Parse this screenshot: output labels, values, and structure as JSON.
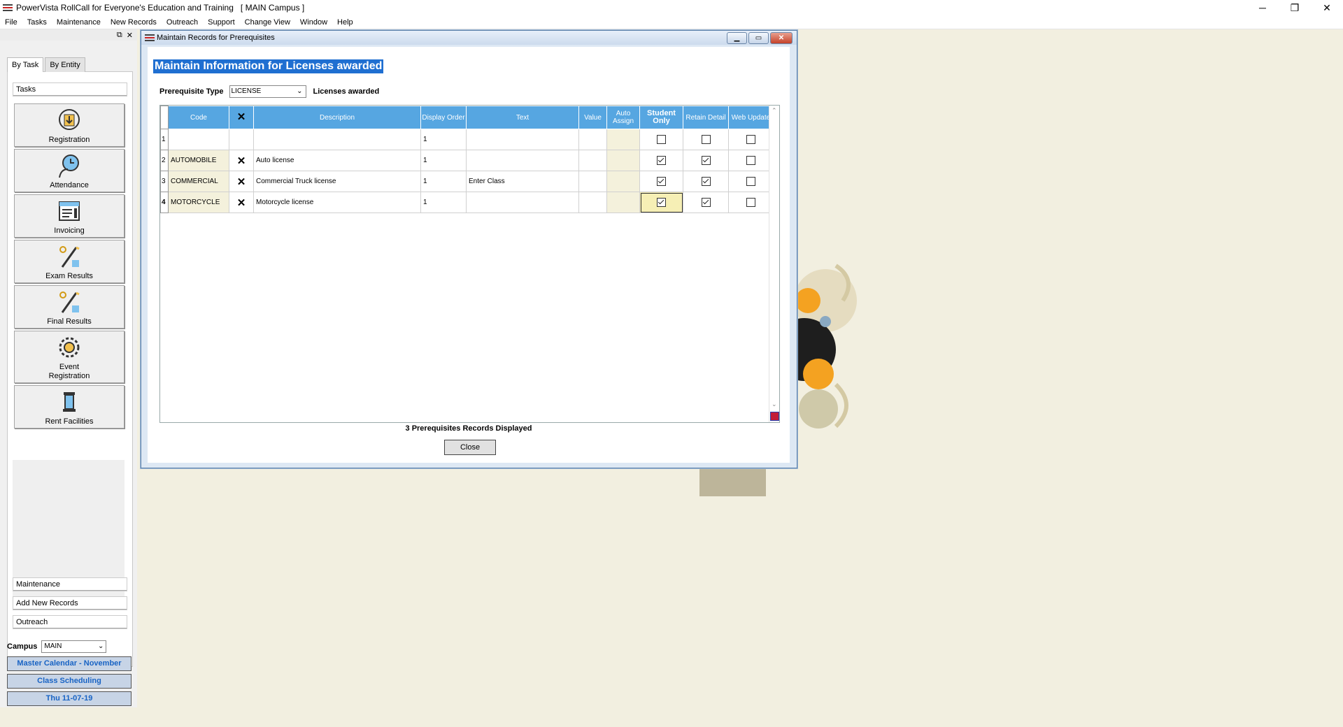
{
  "window": {
    "title": "PowerVista RollCall for Everyone's Education and Training   [ MAIN Campus ]",
    "controls": {
      "minimize": "─",
      "restore": "❐",
      "close": "✕"
    }
  },
  "menu": [
    "File",
    "Tasks",
    "Maintenance",
    "New Records",
    "Outreach",
    "Support",
    "Change View",
    "Window",
    "Help"
  ],
  "left_panel": {
    "top_icons": {
      "restore": "⧉",
      "close": "✕"
    },
    "tabs": [
      "By Task",
      "By Entity"
    ],
    "tasks_header": "Tasks",
    "tasks": [
      {
        "label": "Registration",
        "icon": "registration-icon"
      },
      {
        "label": "Attendance",
        "icon": "attendance-icon"
      },
      {
        "label": "Invoicing",
        "icon": "invoicing-icon"
      },
      {
        "label": "Exam Results",
        "icon": "exam-results-icon"
      },
      {
        "label": "Final Results",
        "icon": "final-results-icon"
      },
      {
        "label": "Event\nRegistration",
        "icon": "event-registration-icon"
      },
      {
        "label": "Rent Facilities",
        "icon": "rent-facilities-icon"
      }
    ],
    "sections": [
      "Maintenance",
      "Add New Records",
      "Outreach"
    ],
    "campus_label": "Campus",
    "campus_value": "MAIN",
    "buttons": [
      "Master Calendar - November",
      "Class Scheduling",
      "Thu 11-07-19"
    ]
  },
  "dialog": {
    "title": "Maintain Records for Prerequisites",
    "heading": "Maintain Information for Licenses awarded",
    "prereq_type_label": "Prerequisite Type",
    "prereq_type_value": "LICENSE",
    "prereq_type_desc": "Licenses awarded",
    "columns": [
      "Code",
      "✕",
      "Description",
      "Display Order",
      "Text",
      "Value",
      "Auto Assign",
      "Student Only",
      "Retain Detail",
      "Web Update"
    ],
    "rows": [
      {
        "num": "1",
        "code": "",
        "delete": "",
        "description": "",
        "display_order": "1",
        "text": "",
        "value": "",
        "auto_assign": "",
        "student_only": false,
        "retain_detail": false,
        "web_update": false
      },
      {
        "num": "2",
        "code": "AUTOMOBILE",
        "delete": "✕",
        "description": "Auto license",
        "display_order": "1",
        "text": "",
        "value": "",
        "auto_assign": "",
        "student_only": true,
        "retain_detail": true,
        "web_update": false
      },
      {
        "num": "3",
        "code": "COMMERCIAL",
        "delete": "✕",
        "description": "Commercial Truck license",
        "display_order": "1",
        "text": "Enter Class",
        "value": "",
        "auto_assign": "",
        "student_only": true,
        "retain_detail": true,
        "web_update": false
      },
      {
        "num": "4",
        "code": "MOTORCYCLE",
        "delete": "✕",
        "description": "Motorcycle license",
        "display_order": "1",
        "text": "",
        "value": "",
        "auto_assign": "",
        "student_only": true,
        "retain_detail": true,
        "web_update": false
      }
    ],
    "status": "3 Prerequisites Records Displayed",
    "close_label": "Close"
  },
  "colors": {
    "header_blue": "#56a6e1",
    "heading_highlight": "#1f6fd1",
    "code_cell": "#f4f1dc",
    "link_blue": "#1863c4",
    "desktop_bg": "#f2efe0"
  }
}
